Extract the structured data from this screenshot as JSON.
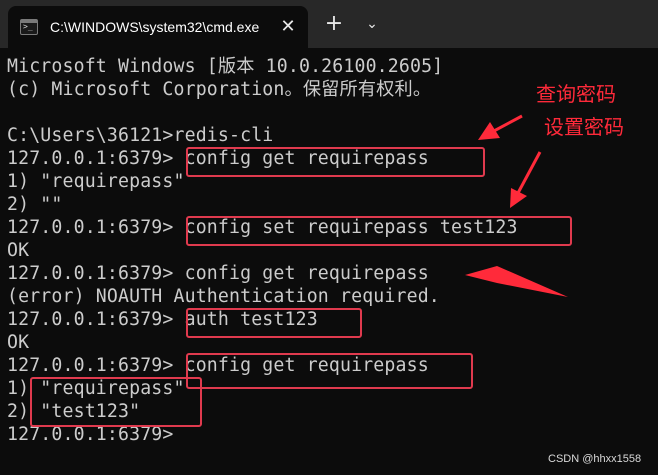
{
  "window": {
    "tab_title": "C:\\WINDOWS\\system32\\cmd.exe",
    "tab_icon": "terminal-icon",
    "close_glyph": "✕",
    "add_tab_glyph": "+",
    "dropdown_glyph": "⌄"
  },
  "console": {
    "lines": [
      "Microsoft Windows [版本 10.0.26100.2605]",
      "(c) Microsoft Corporation。保留所有权利。",
      "",
      "C:\\Users\\36121>redis-cli",
      "127.0.0.1:6379> config get requirepass",
      "1) \"requirepass\"",
      "2) \"\"",
      "127.0.0.1:6379> config set requirepass test123",
      "OK",
      "127.0.0.1:6379> config get requirepass",
      "(error) NOAUTH Authentication required.",
      "127.0.0.1:6379> auth test123",
      "OK",
      "127.0.0.1:6379> config get requirepass",
      "1) \"requirepass\"",
      "2) \"test123\"",
      "127.0.0.1:6379>"
    ]
  },
  "annotations": {
    "query_password": "查询密码",
    "set_password": "设置密码",
    "color": "#e03a4e"
  },
  "watermark": "CSDN @hhxx1558"
}
